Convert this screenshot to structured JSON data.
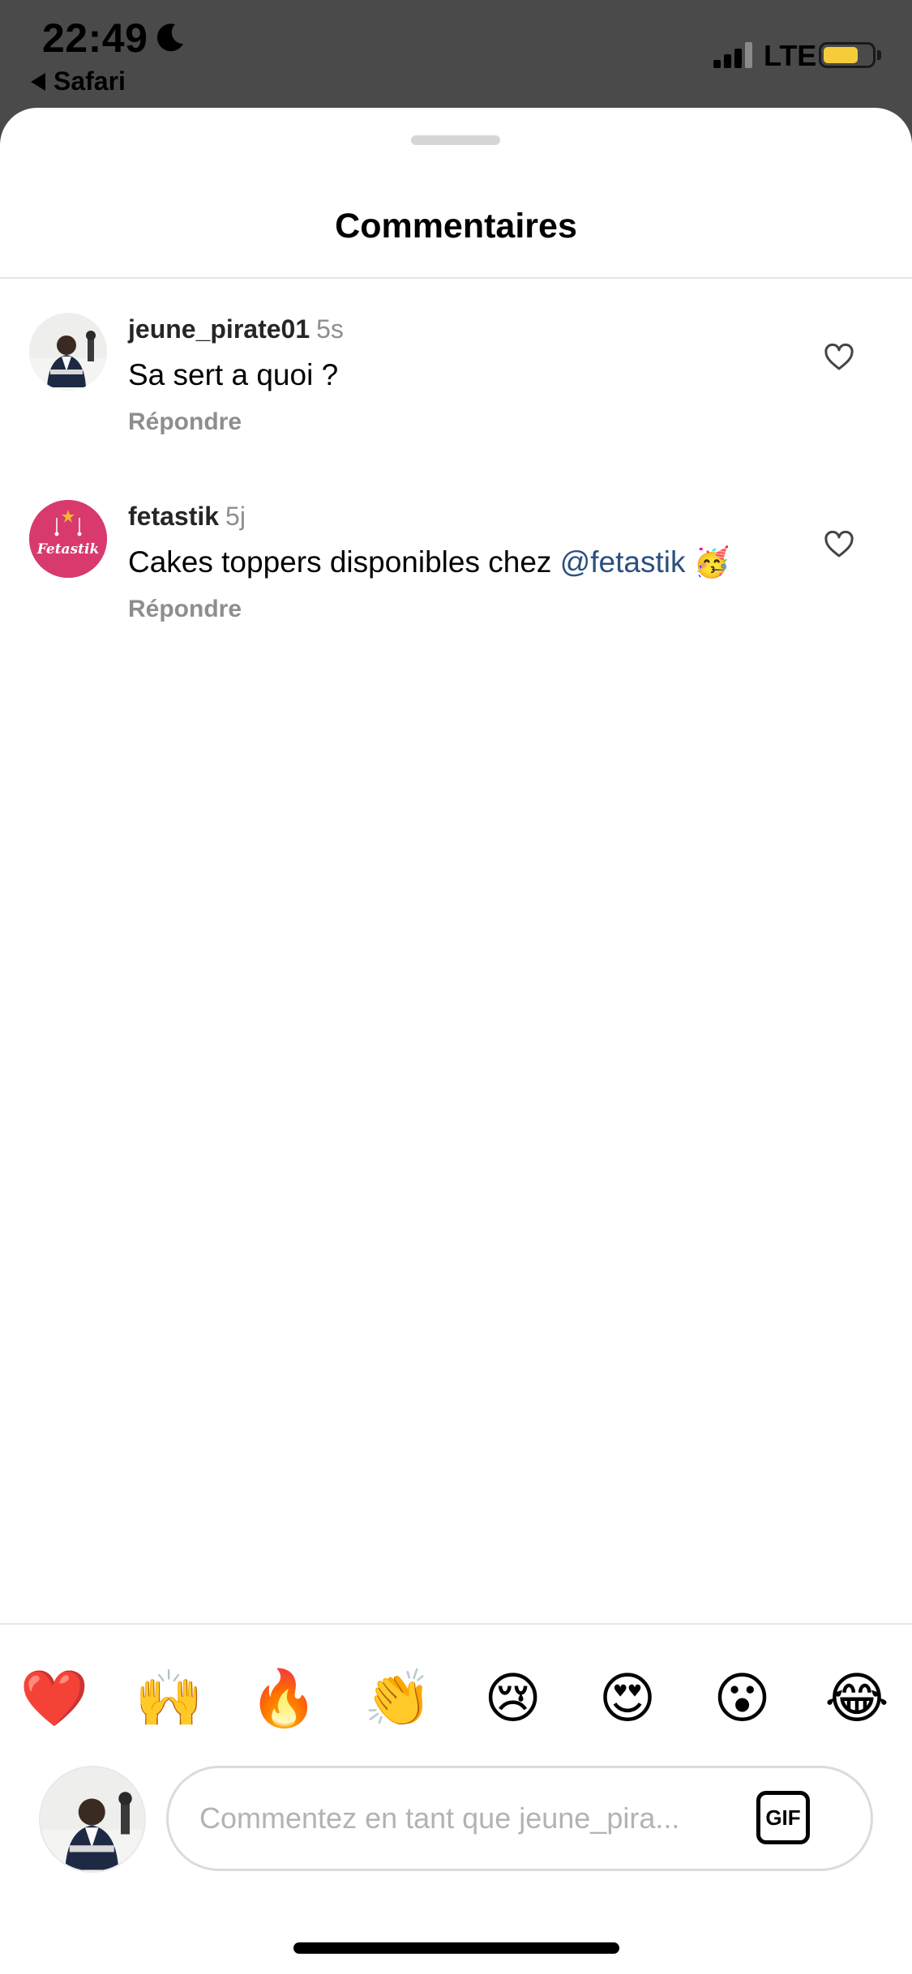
{
  "status_bar": {
    "time": "22:49",
    "back_app": "Safari",
    "network": "LTE",
    "battery_level": 0.72,
    "battery_color": "#f6cc3c"
  },
  "sheet": {
    "title": "Commentaires"
  },
  "comments": [
    {
      "username": "jeune_pirate01",
      "age": "5s",
      "text": "Sa sert a quoi ?",
      "mention": "",
      "emoji": "",
      "reply_label": "Répondre",
      "avatar_icon": "man-in-suit-photo"
    },
    {
      "username": "fetastik",
      "age": "5j",
      "text": "Cakes toppers disponibles chez ",
      "mention": "@fetastik",
      "emoji": "🥳",
      "reply_label": "Répondre",
      "avatar_icon": "fetastik-logo",
      "avatar_logo_text": "Fetastik"
    }
  ],
  "quick_emojis": [
    "❤️",
    "🙌",
    "🔥",
    "👏",
    "😢",
    "😍",
    "😮",
    "😂"
  ],
  "composer": {
    "placeholder": "Commentez en tant que jeune_pira...",
    "gif_label": "GIF"
  },
  "colors": {
    "mention": "#2b5080",
    "secondary_text": "#8e8e8e",
    "fetastik_brand": "#d83a6e"
  }
}
